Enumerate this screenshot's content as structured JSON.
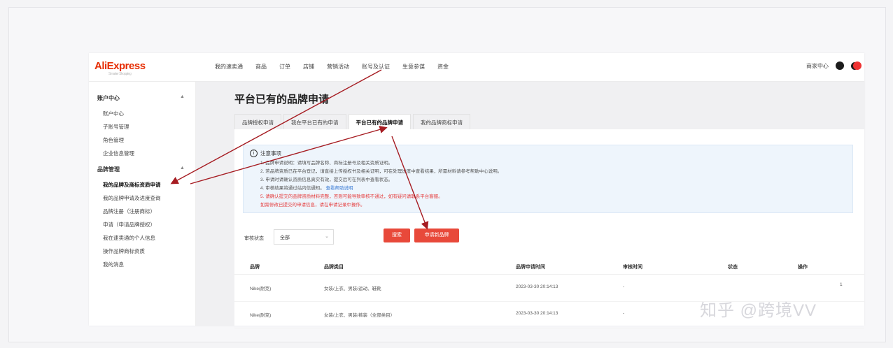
{
  "header": {
    "logo": "AliExpress",
    "logo_sub": "Smarter Shopping",
    "nav": [
      "我的速卖通",
      "商品",
      "订单",
      "店铺",
      "营销活动",
      "账号及认证",
      "生意参谋",
      "资金"
    ],
    "account": "商家中心"
  },
  "sidebar": {
    "groups": [
      {
        "label": "账户中心",
        "items": [
          "账户中心",
          "子账号管理",
          "角色管理",
          "企业信息管理"
        ]
      },
      {
        "label": "品牌管理",
        "items": [
          "我的品牌及商标资质申请",
          "我的品牌申请及进度查询",
          "品牌注册（注册商标）",
          "申请（申请品牌授权）",
          "我在速卖通的个人信息",
          "操作品牌商标资质",
          "我的消息"
        ]
      }
    ]
  },
  "main": {
    "page_title": "平台已有的品牌申请",
    "tabs": [
      "品牌授权申请",
      "我在平台已有的申请",
      "平台已有的品牌申请",
      "我的品牌商标申请"
    ],
    "active_tab": 2,
    "notice": {
      "title": "注意事项",
      "lines": [
        "1. 品牌申请说明：请填写品牌名称、商标注册号及相关资质证明。",
        "2. 若品牌资质已在平台登记，请直接上传授权书及相关证明，可在处理进度中查看结果，所需材料请参考帮助中心说明。",
        "3. 申请时请确认资质信息真实有效，提交后可在列表中查看状态。",
        "4. 审核结果将通过站内信通知。",
        "5. 请确认提交的品牌资质材料完整，否则可能导致审核不通过，如有疑问请联系平台客服。"
      ],
      "blue_link": "查看帮助说明",
      "bottom_line": "如需修改已提交的申请信息，请在申请记录中操作。"
    },
    "filter": {
      "label": "审核状态",
      "select_value": "全部",
      "search_button": "搜索",
      "apply_button": "申请新品牌"
    },
    "table": {
      "headers": [
        "品牌",
        "品牌类目",
        "品牌申请时间",
        "审核时间",
        "状态",
        "操作"
      ],
      "rows": [
        [
          "Nike(耐克)",
          "女装/上衣、男装/运动、鞋靴",
          "2023-03-30 20:14:13",
          "-",
          "",
          "1"
        ],
        [
          "Nike(耐克)",
          "女装/上衣、男装/裤装（全部类目）",
          "2023-03-30 20:14:13",
          "-",
          "",
          ""
        ]
      ]
    }
  },
  "watermark": "知乎 @跨境VV",
  "colors": {
    "brand": "#e62e04",
    "button": "#e8493a",
    "arrow": "#a61c22",
    "notice_bg": "#eef5fc"
  }
}
